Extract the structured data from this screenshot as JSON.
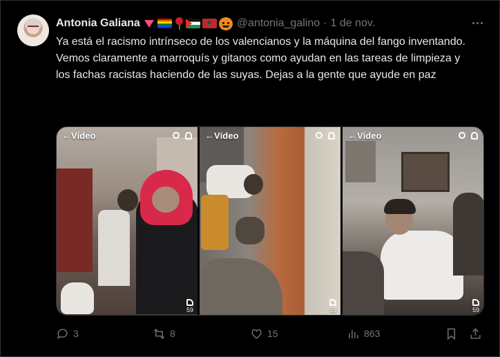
{
  "tweet": {
    "display_name": "Antonia Galiana",
    "handle": "@antonia_galino",
    "separator": "·",
    "date": "1 de nov.",
    "text": "Ya está el racismo intrínseco de los valencianos y la máquina del fango inventando.\nVemos claramente a marroquís y gitanos como ayudan en las tareas de limpieza y los fachas racistas haciendo de las suyas. Dejas a la gente que ayude en paz",
    "name_emoji": [
      "heart-icon",
      "rainbow-flag-icon",
      "rose-icon",
      "palestine-flag-icon",
      "morocco-flag-icon",
      "jack-o-lantern-icon"
    ]
  },
  "media": {
    "panels": [
      {
        "label": "Vídeo",
        "likes": "59"
      },
      {
        "label": "Vídeo",
        "likes": "59"
      },
      {
        "label": "Vídeo",
        "likes": "59"
      }
    ]
  },
  "actions": {
    "replies": "3",
    "reposts": "8",
    "likes": "15",
    "views": "863"
  },
  "colors": {
    "background": "#000000",
    "text_primary": "#e7e9ea",
    "text_secondary": "#71767b",
    "border": "#2f3336"
  }
}
